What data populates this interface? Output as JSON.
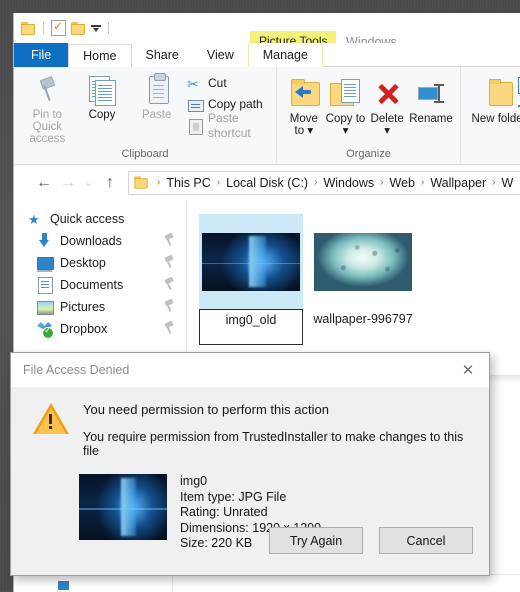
{
  "window": {
    "context_tab_label": "Picture Tools",
    "title": "Windows",
    "quick_access": [
      {
        "name": "folder-icon",
        "label": "Properties folder"
      },
      {
        "name": "properties-icon",
        "label": "Properties"
      },
      {
        "name": "new-folder-icon",
        "label": "New folder"
      },
      {
        "name": "customize-dropdown-icon",
        "label": "Customize Quick Access Toolbar"
      }
    ]
  },
  "ribbon": {
    "tabs": [
      {
        "label": "File",
        "state": "file"
      },
      {
        "label": "Home",
        "state": "active"
      },
      {
        "label": "Share",
        "state": "normal"
      },
      {
        "label": "View",
        "state": "normal"
      },
      {
        "label": "Manage",
        "state": "contextual"
      }
    ],
    "groups": [
      {
        "label": "Clipboard",
        "big_buttons": [
          {
            "label": "Pin to Quick access",
            "icon": "pin-icon",
            "disabled": true
          },
          {
            "label": "Copy",
            "icon": "copy-icon",
            "disabled": false
          },
          {
            "label": "Paste",
            "icon": "paste-icon",
            "disabled": true
          }
        ],
        "small_buttons": [
          {
            "label": "Cut",
            "icon": "scissors-icon",
            "disabled": false
          },
          {
            "label": "Copy path",
            "icon": "copy-path-icon",
            "disabled": false
          },
          {
            "label": "Paste shortcut",
            "icon": "paste-shortcut-icon",
            "disabled": true
          }
        ]
      },
      {
        "label": "Organize",
        "big_buttons": [
          {
            "label": "Move to",
            "icon": "move-to-icon",
            "disabled": false
          },
          {
            "label": "Copy to",
            "icon": "copy-to-icon",
            "disabled": false
          },
          {
            "label": "Delete",
            "icon": "delete-x-icon",
            "disabled": false
          },
          {
            "label": "Rename",
            "icon": "rename-icon",
            "disabled": false
          }
        ],
        "small_buttons": []
      },
      {
        "label": "",
        "big_buttons": [
          {
            "label": "New folder",
            "icon": "new-folder-icon",
            "disabled": false
          }
        ],
        "small_buttons": []
      }
    ]
  },
  "address_bar": {
    "back_label": "←",
    "forward_label": "→",
    "recent_label": "⌄",
    "up_label": "↑",
    "breadcrumbs": [
      "This PC",
      "Local Disk (C:)",
      "Windows",
      "Web",
      "Wallpaper",
      "W"
    ],
    "separator": "›"
  },
  "nav_pane": {
    "items": [
      {
        "label": "Quick access",
        "icon": "quick-access-star-icon",
        "pinned": false,
        "root": true
      },
      {
        "label": "Downloads",
        "icon": "downloads-arrow-icon",
        "pinned": true,
        "root": false
      },
      {
        "label": "Desktop",
        "icon": "desktop-icon",
        "pinned": true,
        "root": false
      },
      {
        "label": "Documents",
        "icon": "documents-icon",
        "pinned": true,
        "root": false
      },
      {
        "label": "Pictures",
        "icon": "pictures-icon",
        "pinned": true,
        "root": false
      },
      {
        "label": "Dropbox",
        "icon": "dropbox-icon",
        "pinned": true,
        "root": false
      }
    ]
  },
  "file_pane": {
    "items": [
      {
        "label": "img0_old",
        "thumb": "win10",
        "selected": true
      },
      {
        "label": "wallpaper-996797",
        "thumb": "clouds",
        "selected": false
      }
    ]
  },
  "dialog": {
    "title": "File Access Denied",
    "close_label": "✕",
    "icon": "warning-triangle-icon",
    "message_primary": "You need permission to perform this action",
    "message_secondary": "You require permission from TrustedInstaller to make changes to this file",
    "file": {
      "name": "img0",
      "item_type": "Item type: JPG File",
      "rating": "Rating: Unrated",
      "dimensions": "Dimensions: 1920 x 1200",
      "size": "Size: 220 KB"
    },
    "buttons": [
      {
        "label": "Try Again",
        "default": true
      },
      {
        "label": "Cancel",
        "default": false
      }
    ]
  },
  "colors": {
    "file_tab_blue": "#0d6fbf",
    "contextual_yellow": "#f4f17a",
    "warning_amber": "#fcc24a",
    "selection_blue": "#cde8f7",
    "desktop_gray": "#4f4f51"
  }
}
